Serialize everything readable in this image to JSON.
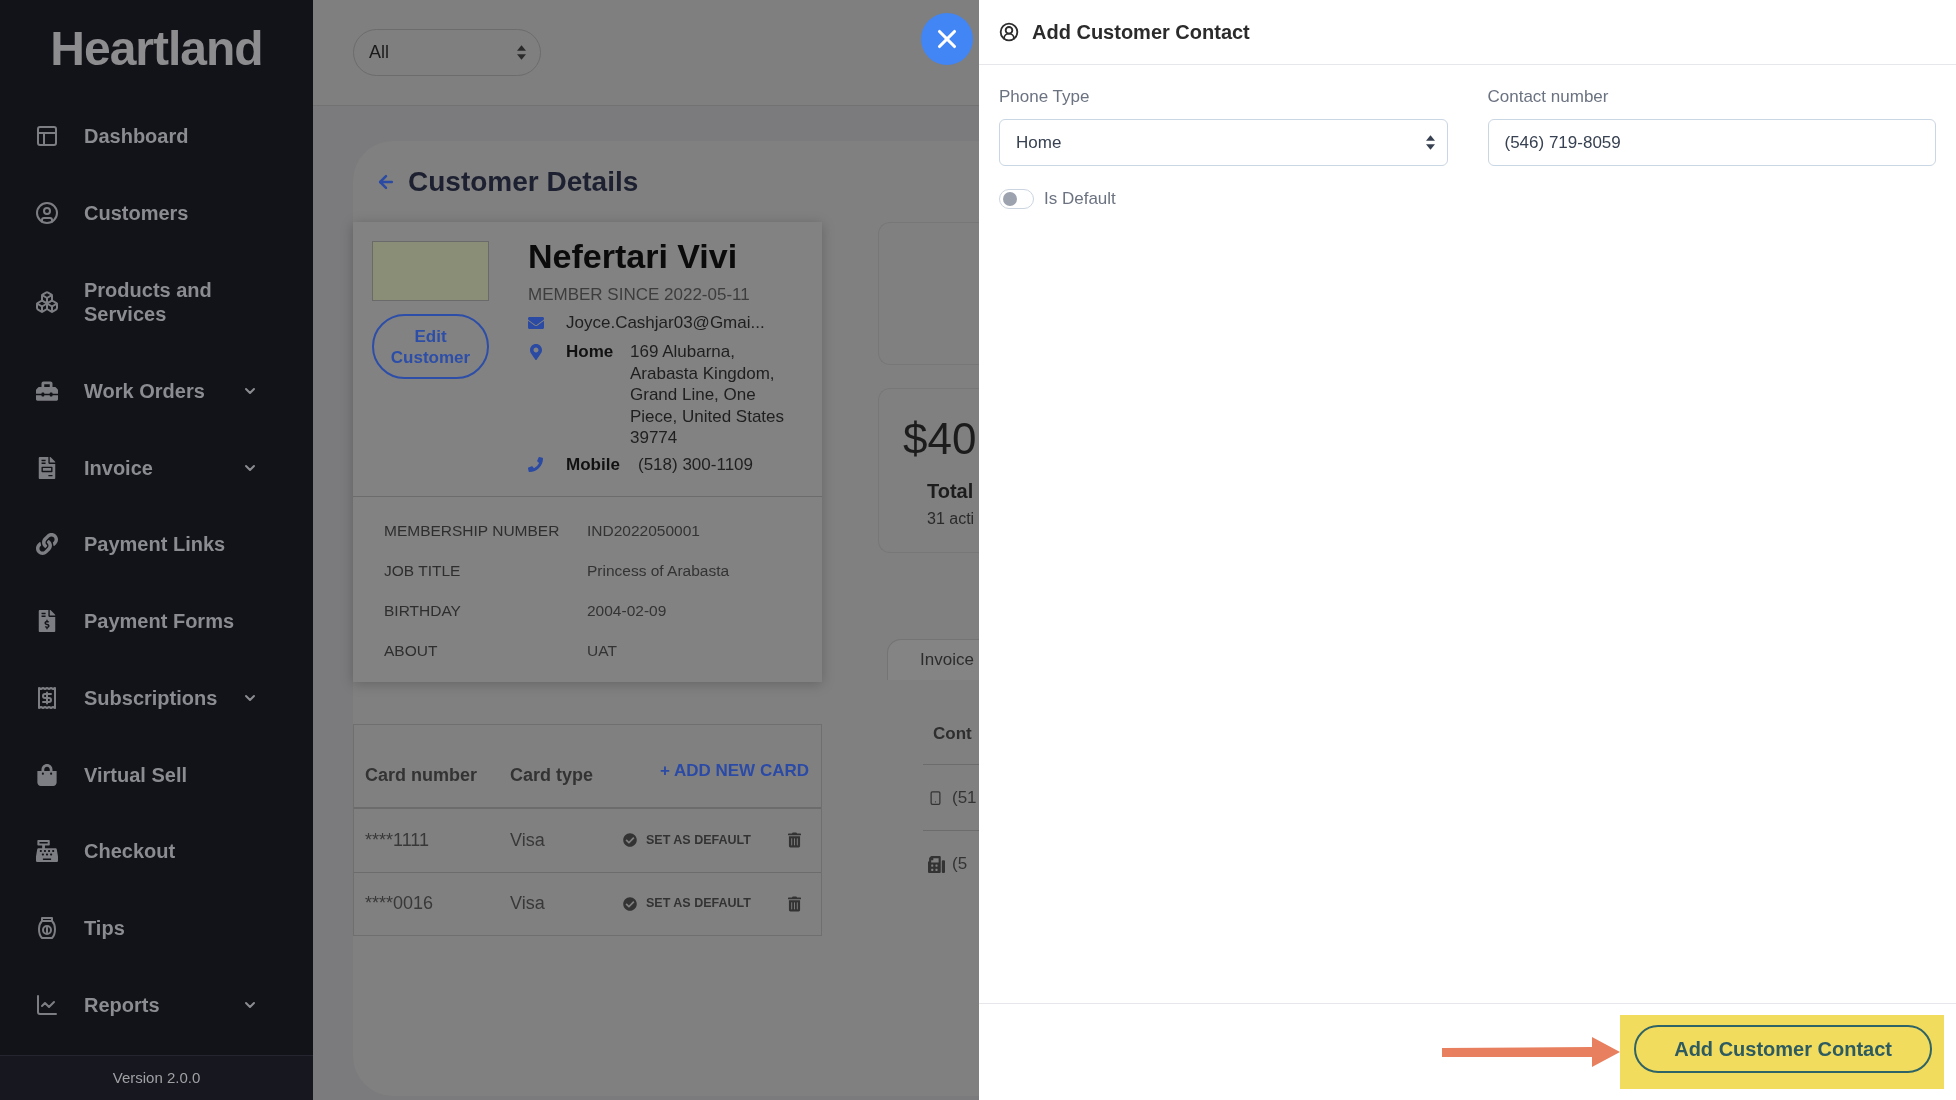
{
  "sidebar": {
    "logo": "Heartland",
    "items": [
      {
        "label": "Dashboard",
        "submenu": false
      },
      {
        "label": "Customers",
        "submenu": false
      },
      {
        "label": "Products and Services",
        "submenu": false
      },
      {
        "label": "Work Orders",
        "submenu": true
      },
      {
        "label": "Invoice",
        "submenu": true
      },
      {
        "label": "Payment Links",
        "submenu": false
      },
      {
        "label": "Payment Forms",
        "submenu": false
      },
      {
        "label": "Subscriptions",
        "submenu": true
      },
      {
        "label": "Virtual Sell",
        "submenu": false
      },
      {
        "label": "Checkout",
        "submenu": false
      },
      {
        "label": "Tips",
        "submenu": false
      },
      {
        "label": "Reports",
        "submenu": true
      }
    ],
    "version": "Version 2.0.0"
  },
  "top_bar": {
    "filter": {
      "value": "All"
    }
  },
  "customer_details": {
    "title": "Customer Details",
    "profile": {
      "name": "Nefertari Vivi",
      "member_since": "MEMBER SINCE 2022-05-11",
      "edit_button": "Edit Customer",
      "email": "Joyce.Cashjar03@Gmai...",
      "address": {
        "label": "Home",
        "text": "169 Alubarna, Arabasta Kingdom, Grand Line, One Piece, United States 39774"
      },
      "phone": {
        "label": "Mobile",
        "value": "(518) 300-1109"
      }
    },
    "details": [
      {
        "label": "MEMBERSHIP NUMBER",
        "value": "IND2022050001"
      },
      {
        "label": "JOB TITLE",
        "value": "Princess of Arabasta"
      },
      {
        "label": "BIRTHDAY",
        "value": "2004-02-09"
      },
      {
        "label": "ABOUT",
        "value": "UAT"
      }
    ]
  },
  "cards": {
    "columns": [
      "Card number",
      "Card type"
    ],
    "add_button": "+ ADD NEW CARD",
    "rows": [
      {
        "number": "****1111",
        "type": "Visa",
        "action": "SET AS DEFAULT"
      },
      {
        "number": "****0016",
        "type": "Visa",
        "action": "SET AS DEFAULT"
      }
    ]
  },
  "summary": {
    "amount": "$40",
    "title": "Total",
    "subtitle": "31 acti"
  },
  "tabs": [
    {
      "label": "Invoice",
      "selected": true
    }
  ],
  "contacts": {
    "heading": "Cont",
    "rows": [
      {
        "kind": "mobile",
        "number": "(51"
      },
      {
        "kind": "fax",
        "number": "(5"
      }
    ]
  },
  "drawer": {
    "title": "Add Customer Contact",
    "phone_type": {
      "label": "Phone Type",
      "value": "Home"
    },
    "contact_number": {
      "label": "Contact number",
      "value": "(546) 719-8059"
    },
    "is_default": {
      "label": "Is Default",
      "on": false
    },
    "submit": "Add Customer Contact"
  }
}
